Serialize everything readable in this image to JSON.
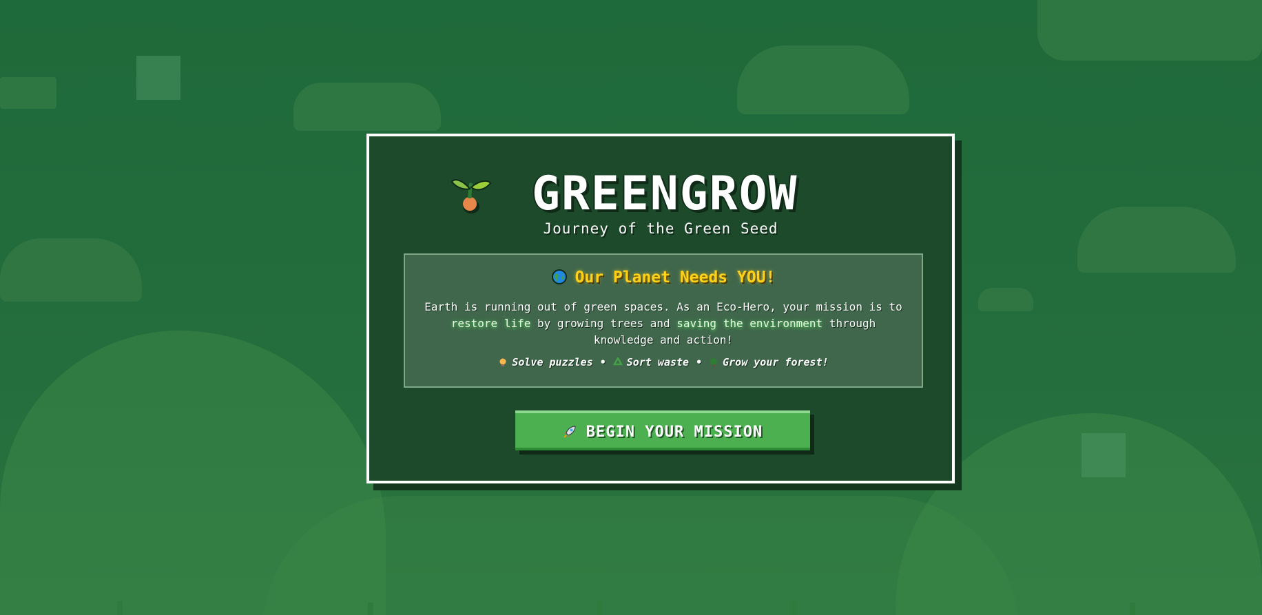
{
  "game": {
    "title": "GREENGROW",
    "subtitle": "Journey of the Green Seed",
    "logo_icon": "sprout-icon"
  },
  "mission": {
    "heading": "Our Planet Needs YOU!",
    "heading_icon": "globe-icon",
    "text_part1": "Earth is running out of green spaces. As an Eco-Hero, your mission is to ",
    "highlight1": "restore life",
    "text_part2": " by growing trees and ",
    "highlight2": "saving the environment",
    "text_part3": " through knowledge and action!",
    "tasks": [
      {
        "icon": "lightbulb-icon",
        "label": "Solve puzzles"
      },
      {
        "icon": "recycle-icon",
        "label": "Sort waste"
      },
      {
        "icon": "tree-icon",
        "label": "Grow your forest!"
      }
    ],
    "separator": "•"
  },
  "start_button": {
    "label": "BEGIN YOUR MISSION",
    "icon": "rocket-icon"
  },
  "colors": {
    "background": "#226b3b",
    "panel": "#1c4a2a",
    "accent_yellow": "#ffd21a",
    "button_green": "#4caf50"
  }
}
